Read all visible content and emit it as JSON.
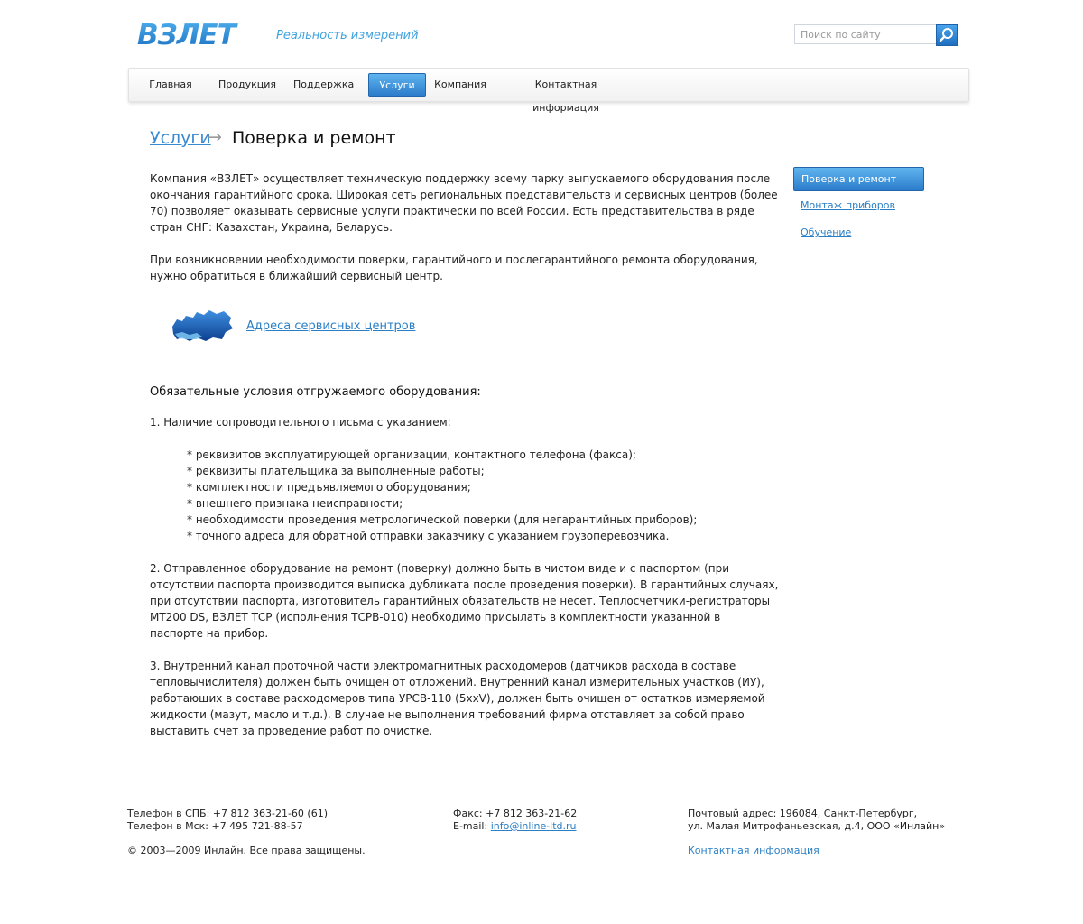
{
  "header": {
    "logo_text": "ВЗЛЕТ",
    "tagline": "Реальность измерений",
    "search_placeholder": "Поиск по сайту",
    "search_icon": "search-icon"
  },
  "nav": {
    "items": [
      {
        "label": "Главная"
      },
      {
        "label": "Продукция"
      },
      {
        "label": "Поддержка"
      },
      {
        "label": "Услуги",
        "active": true
      },
      {
        "label": "Компания"
      },
      {
        "label": "Контактная информация"
      }
    ]
  },
  "breadcrumb": {
    "parent": "Услуги",
    "arrow": "→",
    "current": "Поверка и ремонт"
  },
  "content": {
    "intro_lines": [
      "Компания «ВЗЛЕТ» осуществляет техническую поддержку всему парку выпускаемого оборудования после",
      "окончания гарантийного срока. Широкая сеть региональных представительств и сервисных центров (более",
      "70) позволяет оказывать сервисные услуги практически по всей России. Есть представительства в ряде",
      "стран СНГ: Казахстан, Украина, Беларусь."
    ],
    "note_lines": [
      "При возникновении необходимости поверки, гарантийного и послегарантийного ремонта оборудования,",
      "нужно обратиться в ближайший сервисный центр."
    ],
    "map_icon": "russia-map-icon",
    "map_link": "Адреса сервисных центров",
    "requirements_title": "Обязательные условия отгружаемого оборудования:",
    "req1_title": "1. Наличие сопроводительного письма с указанием:",
    "req1_items": [
      "* реквизитов эксплуатирующей организации, контактного телефона (факса);",
      "* реквизиты плательщика за выполненные работы;",
      "* комплектности предъявляемого оборудования;",
      "* внешнего признака неисправности;",
      "* необходимости проведения метрологической поверки (для негарантийных приборов);",
      "* точного адреса для обратной отправки заказчику с указанием грузоперевозчика."
    ],
    "req2_lines": [
      "2. Отправленное оборудование на ремонт (поверку) должно быть в чистом виде и с паспортом (при",
      "отсутствии паспорта производится выписка дубликата после проведения поверки). В гарантийных случаях,",
      "при отсутствии паспорта, изготовитель гарантийных обязательств не несет. Теплосчетчики-регистраторы",
      "МТ200 DS, ВЗЛЕТ ТСР (исполнения ТСРВ-010) необходимо присылать в комплектности указанной в",
      "паспорте на прибор."
    ],
    "req3_lines": [
      "3. Внутренний канал проточной части электромагнитных расходомеров (датчиков расхода в составе",
      "тепловычислителя) должен быть очищен от отложений. Внутренний канал измерительных участков (ИУ),",
      "работающих в составе расходомеров типа УРСВ-110 (5xxV), должен быть очищен от остатков измеряемой",
      "жидкости (мазут, масло и т.д.). В случае не выполнения требований фирма отставляет за собой право",
      "выставить счет за проведение работ по очистке."
    ]
  },
  "sidebar": {
    "items": [
      {
        "label": "Поверка и ремонт",
        "active": true
      },
      {
        "label": "Монтаж приборов"
      },
      {
        "label": "Обучение"
      }
    ]
  },
  "footer": {
    "phone_spb": "Телефон в СПБ: +7 812 363-21-60 (61)",
    "phone_msk": "Телефон в Мск: +7 495 721-88-57",
    "copyright": "© 2003—2009 Инлайн. Все права защищены.",
    "fax": "Факс: +7 812 363-21-62",
    "email_label": "E-mail: ",
    "email": "info@inline-ltd.ru",
    "address_line1": "Почтовый адрес: 196084, Санкт-Петербург,",
    "address_line2": "ул. Малая Митрофаньевская, д.4, ООО «Инлайн»",
    "contacts_link": "Контактная информация"
  },
  "colors": {
    "accent": "#2c7ccb",
    "link": "#2a7fc5",
    "logo": "#2a86d4"
  }
}
